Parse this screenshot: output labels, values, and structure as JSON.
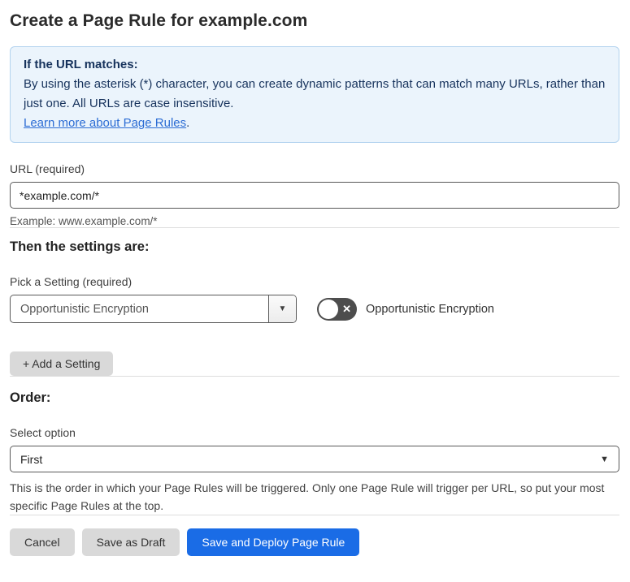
{
  "page": {
    "title": "Create a Page Rule for example.com"
  },
  "info_box": {
    "heading": "If the URL matches:",
    "body": "By using the asterisk (*) character, you can create dynamic patterns that can match many URLs, rather than just one. All URLs are case insensitive.",
    "link_text": "Learn more about Page Rules",
    "link_suffix": "."
  },
  "url_field": {
    "label": "URL (required)",
    "value": "*example.com/*",
    "helper": "Example: www.example.com/*"
  },
  "settings_section": {
    "heading": "Then the settings are:",
    "setting_label": "Pick a Setting (required)",
    "setting_value": "Opportunistic Encryption",
    "toggle_state": "off",
    "toggle_label": "Opportunistic Encryption",
    "add_button_label": "+ Add a Setting"
  },
  "order_section": {
    "heading": "Order:",
    "label": "Select option",
    "value": "First",
    "helper": "This is the order in which your Page Rules will be triggered. Only one Page Rule will trigger per URL, so put your most specific Page Rules at the top."
  },
  "footer": {
    "cancel_label": "Cancel",
    "save_draft_label": "Save as Draft",
    "save_deploy_label": "Save and Deploy Page Rule"
  },
  "icons": {
    "toggle_off_x": "✕",
    "dropdown_arrow": "▼",
    "select_arrow": "▼"
  },
  "colors": {
    "primary_blue": "#1a6ce6",
    "info_background": "#ebf4fc",
    "info_border": "#b3d3ef",
    "info_text": "#16325c",
    "link_blue": "#2b6cd4",
    "toggle_off_bg": "#4d4d4d",
    "gray_button_bg": "#d9d9d9",
    "input_border": "#595959"
  }
}
